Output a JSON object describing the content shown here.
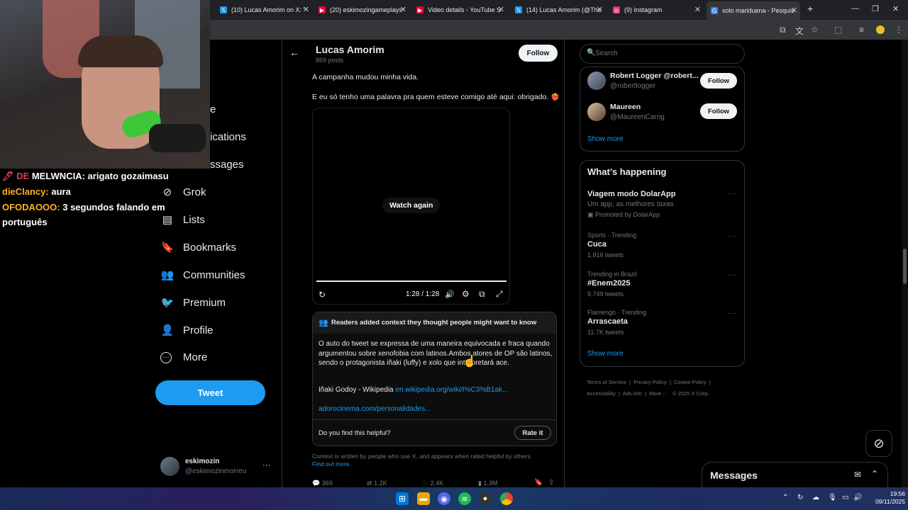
{
  "browser": {
    "tabs": [
      {
        "title": "(10) Lucas Amorim on X: '",
        "icon_color": "#1d9bf0",
        "active": false
      },
      {
        "title": "(20) eskimozingameplays",
        "icon_color": "#ff0033",
        "active": false
      },
      {
        "title": "Video details - YouTube S",
        "icon_color": "#ff0033",
        "active": false
      },
      {
        "title": "(14) Lucas Amorim (@The",
        "icon_color": "#1d9bf0",
        "active": false
      },
      {
        "title": "(9) Instagram",
        "icon_color": "#e1306c",
        "active": false
      },
      {
        "title": "xolo mariduena - Pesquis",
        "icon_color": "#4285f4",
        "active": true
      }
    ]
  },
  "stream_chat": [
    {
      "user": "MELWNCIA:",
      "msg": "arigato gozaimasu",
      "user_color": "#ffffff",
      "badges": "🖊 DE"
    },
    {
      "user": "dieClancy:",
      "msg": "aura",
      "user_color": "#ffb020",
      "badges": ""
    },
    {
      "user": "OFODAOOO:",
      "msg": "3 segundos falando em",
      "user_color": "#ffb020",
      "badges": ""
    },
    {
      "user": "",
      "msg": "português",
      "user_color": "#ffffff",
      "badges": ""
    }
  ],
  "nav": {
    "partial": [
      "e",
      "ications",
      "ssages"
    ],
    "items": [
      {
        "label": "Grok",
        "icon": "grok-icon",
        "glyph": "⊘"
      },
      {
        "label": "Lists",
        "icon": "lists-icon",
        "glyph": "▤"
      },
      {
        "label": "Bookmarks",
        "icon": "bookmark-icon",
        "glyph": "🔖"
      },
      {
        "label": "Communities",
        "icon": "communities-icon",
        "glyph": "👥"
      },
      {
        "label": "Premium",
        "icon": "premium-icon",
        "glyph": "🐦"
      },
      {
        "label": "Profile",
        "icon": "profile-icon",
        "glyph": "👤"
      },
      {
        "label": "More",
        "icon": "more-icon",
        "glyph": "⋯"
      }
    ],
    "tweet_button": "Tweet",
    "account": {
      "name": "eskimozin",
      "handle": "@eskimozinmorreu",
      "more": "···"
    }
  },
  "header": {
    "name": "Lucas Amorim",
    "posts": "869 posts",
    "follow": "Follow"
  },
  "tweet": {
    "line1": "A campanha mudou minha vida.",
    "line2": "E eu só tenho uma palavra pra quem esteve comigo até aqui: obrigado. ❤️‍🔥",
    "video": {
      "watch_again": "Watch again",
      "time": "1:28 / 1:28",
      "progress": 1.0
    }
  },
  "community_note": {
    "header": "Readers added context they thought people might want to know",
    "body": "O auto do tweet se expressa de uma maneira equivocada e fraca quando argumentou sobre xenofobia com latinos.Ambos atores de OP são latinos, sendo o protagonista iñaki (luffy) e xolo que interpretará ace.",
    "source_label": "Iñaki Godoy - Wikipedia",
    "source_link": "en.wikipedia.org/wiki/I%C3%B1ak...",
    "link2": "adorocinema.com/personalidades...",
    "helpful_q": "Do you find this helpful?",
    "rate": "Rate it",
    "footer": "Context is written by people who use X, and appears when rated helpful by others.",
    "find_out": "Find out more."
  },
  "actions": {
    "replies": "369",
    "retweets": "1.2K",
    "likes": "2.4K",
    "views": "1.3M"
  },
  "sidebar": {
    "search_placeholder": "Search",
    "follow_suggestions": [
      {
        "name": "Robert Logger @robert...",
        "handle": "@robertlogger",
        "button": "Follow"
      },
      {
        "name": "Maureen",
        "handle": "@MaureenCarrig",
        "button": "Follow"
      }
    ],
    "show_more": "Show more",
    "happening_title": "What’s happening",
    "trends": [
      {
        "context": "",
        "title": "Viagem modo DolarApp",
        "sub": "Um app, as melhores taxas",
        "meta": "Promoted by DolarApp"
      },
      {
        "context": "Sports · Trending",
        "title": "Cuca",
        "sub": "",
        "meta": "1,916 tweets"
      },
      {
        "context": "Trending in Brazil",
        "title": "#Enem2025",
        "sub": "",
        "meta": "9,749 tweets"
      },
      {
        "context": "Flamengo · Trending",
        "title": "Arrascaeta",
        "sub": "",
        "meta": "11.7K tweets"
      }
    ],
    "show_more_2": "Show more",
    "footer_links": [
      "Terms of Service",
      "Privacy Policy",
      "Cookie Policy",
      "Accessibility",
      "Ads info",
      "More ···",
      "© 2025 X Corp."
    ],
    "messages": "Messages"
  },
  "taskbar": {
    "time": "19:56",
    "date": "09/11/2025"
  }
}
